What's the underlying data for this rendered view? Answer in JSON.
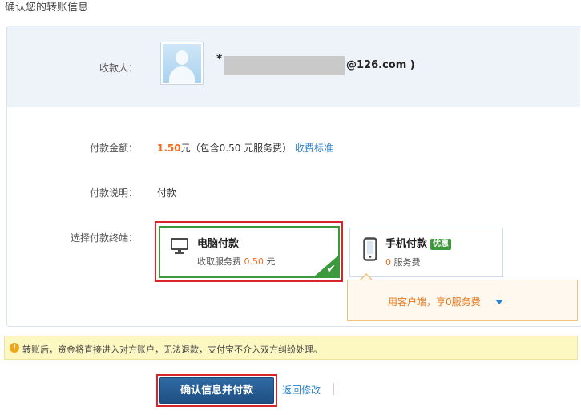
{
  "page": {
    "title": "确认您的转账信息"
  },
  "payee": {
    "label": "收款人：",
    "prefix": "*",
    "email_visible": "@126.com )"
  },
  "amount": {
    "label": "付款金额：",
    "value": "1.50",
    "unit": "元",
    "note": "（包含0.50 元服务费）",
    "fee_link": "收费标准"
  },
  "description": {
    "label": "付款说明：",
    "value": "付款"
  },
  "terminal": {
    "label": "选择付款终端：",
    "pc": {
      "title": "电脑付款",
      "fee_prefix": "收取服务费",
      "fee": "0.50",
      "fee_unit": "元",
      "selected": true
    },
    "mobile": {
      "title": "手机付款",
      "badge": "优惠",
      "fee": "0",
      "fee_suffix": "服务费"
    },
    "promo": "用客户端，享0服务费"
  },
  "warning": {
    "text": "转账后，资金将直接进入对方账户，无法退款，支付宝不介入双方纠纷处理。"
  },
  "actions": {
    "submit": "确认信息并付款",
    "back": "返回修改"
  },
  "colors": {
    "accent": "#2b80c8",
    "selected": "#3c9a3d",
    "amount": "#f26b1d",
    "highlight": "#d8242b"
  }
}
